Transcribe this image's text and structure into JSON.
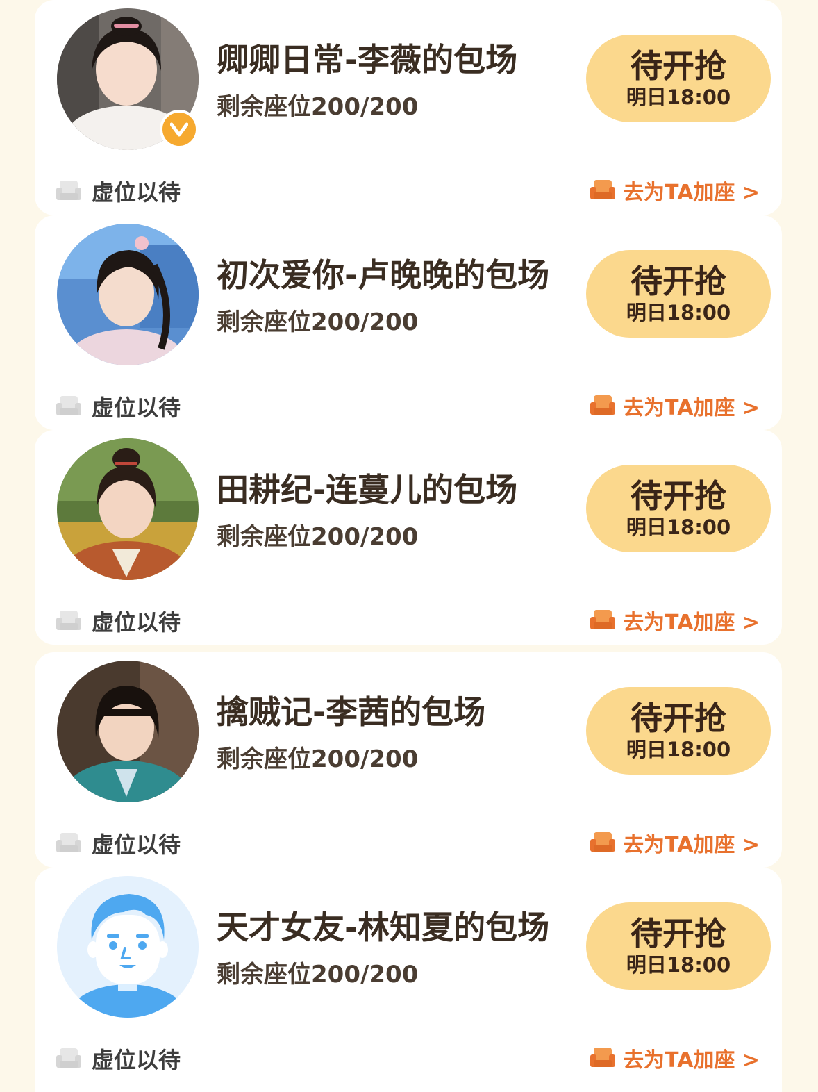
{
  "colors": {
    "page_bg": "#fdf8ea",
    "card_bg": "#ffffff",
    "button_bg": "#fbd88d",
    "accent_orange": "#e8712d",
    "badge_orange": "#f6a92f"
  },
  "icons": {
    "vip_badge": "v-badge-icon",
    "empty_seat": "sofa-icon",
    "add_seat": "orange-sofa-icon"
  },
  "sessions": [
    {
      "title": "卿卿日常-李薇的包场",
      "seats": "剩余座位200/200",
      "button_main": "待开抢",
      "button_time": "明日18:00",
      "status": "虚位以待",
      "action": "去为TA加座 >",
      "verified": true
    },
    {
      "title": "初次爱你-卢晚晚的包场",
      "seats": "剩余座位200/200",
      "button_main": "待开抢",
      "button_time": "明日18:00",
      "status": "虚位以待",
      "action": "去为TA加座 >",
      "verified": false
    },
    {
      "title": "田耕纪-连蔓儿的包场",
      "seats": "剩余座位200/200",
      "button_main": "待开抢",
      "button_time": "明日18:00",
      "status": "虚位以待",
      "action": "去为TA加座 >",
      "verified": false
    },
    {
      "title": "擒贼记-李茜的包场",
      "seats": "剩余座位200/200",
      "button_main": "待开抢",
      "button_time": "明日18:00",
      "status": "虚位以待",
      "action": "去为TA加座 >",
      "verified": false
    },
    {
      "title": "天才女友-林知夏的包场",
      "seats": "剩余座位200/200",
      "button_main": "待开抢",
      "button_time": "明日18:00",
      "status": "虚位以待",
      "action": "去为TA加座 >",
      "verified": false
    }
  ]
}
